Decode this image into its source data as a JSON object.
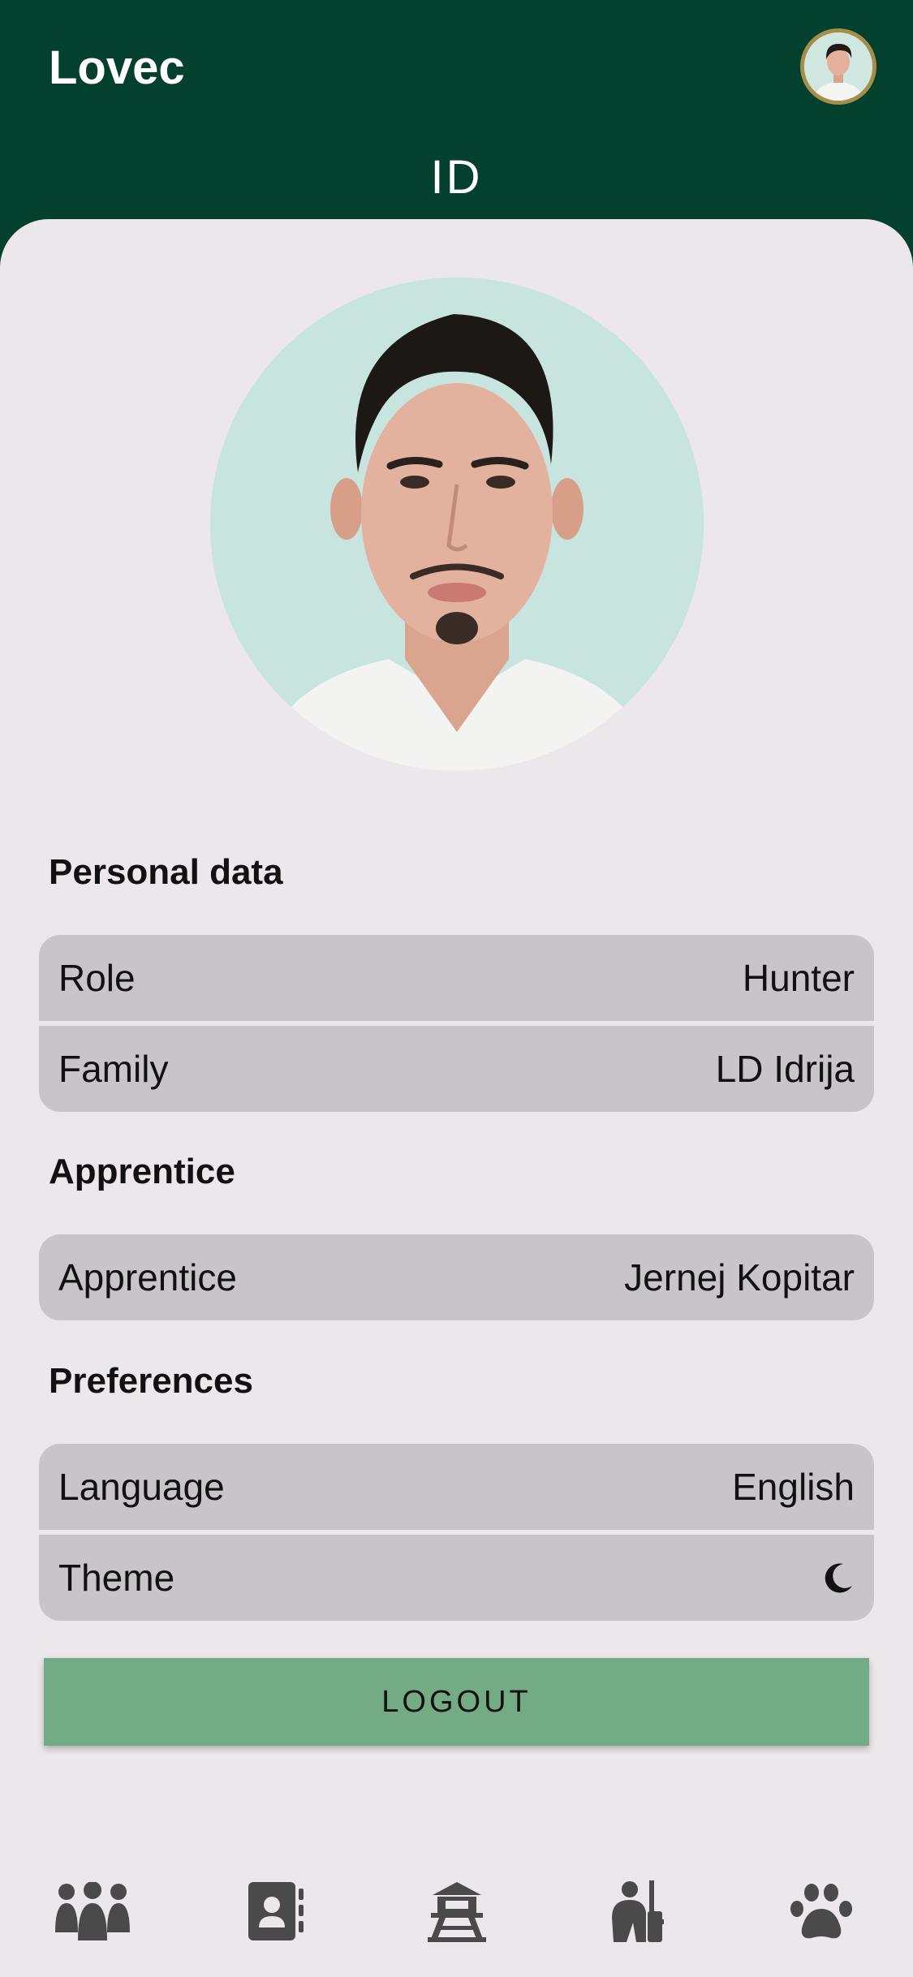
{
  "app": {
    "title": "Lovec",
    "active_tab": "ID"
  },
  "header": {
    "avatar_icon": "profile-avatar"
  },
  "personal_data": {
    "title": "Personal data",
    "rows": [
      {
        "label": "Role",
        "value": "Hunter"
      },
      {
        "label": "Family",
        "value": "LD Idrija"
      }
    ]
  },
  "apprentice": {
    "title": "Apprentice",
    "rows": [
      {
        "label": "Apprentice",
        "value": "Jernej Kopitar"
      }
    ]
  },
  "preferences": {
    "title": "Preferences",
    "language_label": "Language",
    "language_value": "English",
    "theme_label": "Theme",
    "theme_icon": "moon-icon"
  },
  "actions": {
    "logout_label": "LOGOUT"
  },
  "bottom_nav": {
    "items": [
      "group-icon",
      "contact-book-icon",
      "watchtower-icon",
      "hunter-icon",
      "paw-icon"
    ]
  },
  "colors": {
    "primary_dark": "#03402D",
    "surface": "#ECE7EB",
    "row_bg": "#C7C5C8",
    "button_green": "#73AB85",
    "avatar_ring": "#A68E48",
    "nav_icon": "#4A4A4A"
  }
}
